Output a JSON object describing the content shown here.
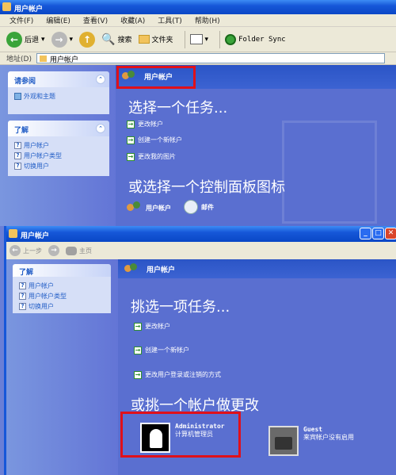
{
  "window1": {
    "title": "用户帐户",
    "menu": [
      "文件(F)",
      "编辑(E)",
      "查看(V)",
      "收藏(A)",
      "工具(T)",
      "帮助(H)"
    ],
    "toolbar": {
      "back": "后退",
      "search": "搜索",
      "folders": "文件夹",
      "folder_sync": "Folder Sync"
    },
    "address": {
      "label": "地址(D)",
      "value": "用户帐户"
    },
    "see_also": {
      "title": "请参阅",
      "items": [
        "外观和主题"
      ]
    },
    "learn": {
      "title": "了解",
      "items": [
        "用户帐户",
        "用户帐户类型",
        "切换用户"
      ]
    },
    "header": "用户帐户",
    "pick_task": "选择一个任务...",
    "tasks": [
      "更改帐户",
      "创建一个新帐户",
      "更改我的图片"
    ],
    "or_pick": "或选择一个控制面板图标",
    "icons": [
      "用户帐户",
      "邮件"
    ]
  },
  "window2": {
    "title": "用户帐户",
    "toolbar": {
      "back": "上一步",
      "home": "主页"
    },
    "learn": {
      "title": "了解",
      "items": [
        "用户帐户",
        "用户帐户类型",
        "切换用户"
      ]
    },
    "header": "用户帐户",
    "pick_task": "挑选一项任务...",
    "tasks": [
      "更改帐户",
      "创建一个新帐户",
      "更改用户登录或注销的方式"
    ],
    "or_pick": "或挑一个帐户做更改",
    "accounts": [
      {
        "name": "Administrator",
        "desc": "计算机管理员"
      },
      {
        "name": "Guest",
        "desc": "来宾帐户没有启用"
      }
    ]
  },
  "colors": {
    "highlight": "#e0101a",
    "xp_blue": "#1657d8",
    "panel_bg": "#5a6fd0"
  }
}
